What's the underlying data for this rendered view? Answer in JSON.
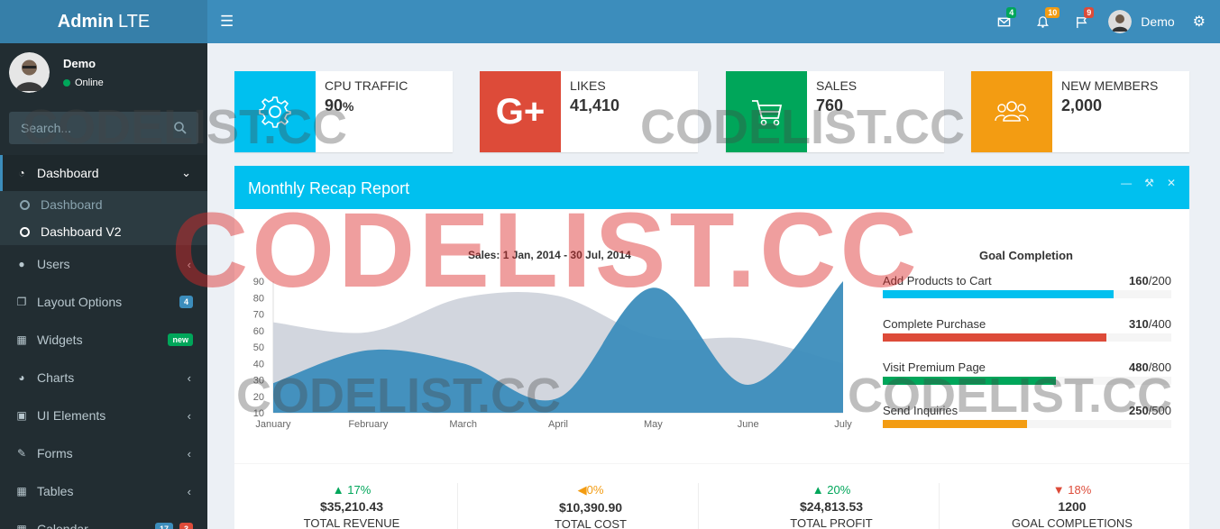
{
  "app": {
    "logo_bold": "Admin",
    "logo_rest": "LTE"
  },
  "navbar": {
    "toggle_icon": "hamburger-icon",
    "messages_badge": "4",
    "notifications_badge": "10",
    "tasks_badge": "9",
    "user_name": "Demo",
    "colors": {
      "messages": "#00a65a",
      "notifications": "#f39c12",
      "tasks": "#dd4b39"
    }
  },
  "sidebar": {
    "user_name": "Demo",
    "user_status": "Online",
    "search_placeholder": "Search...",
    "items": [
      {
        "label": "Dashboard",
        "icon": "dashboard-icon",
        "active": true
      },
      {
        "label": "Users",
        "icon": "users-icon"
      },
      {
        "label": "Layout Options",
        "icon": "files-icon",
        "badge": "4",
        "badge_color": "#3c8dbc"
      },
      {
        "label": "Widgets",
        "icon": "grid-icon",
        "badge": "new",
        "badge_color": "#00a65a"
      },
      {
        "label": "Charts",
        "icon": "pie-chart-icon"
      },
      {
        "label": "UI Elements",
        "icon": "laptop-icon"
      },
      {
        "label": "Forms",
        "icon": "edit-icon"
      },
      {
        "label": "Tables",
        "icon": "table-icon"
      },
      {
        "label": "Calendar",
        "icon": "calendar-icon",
        "badge": "17",
        "badge2": "3"
      }
    ],
    "subitems": [
      "Dashboard",
      "Dashboard V2"
    ]
  },
  "info_boxes": [
    {
      "label": "CPU TRAFFIC",
      "value": "90",
      "unit": "%",
      "color": "#00c0ef",
      "icon": "gear-icon"
    },
    {
      "label": "LIKES",
      "value": "41,410",
      "color": "#dd4b39",
      "icon": "google-plus-icon"
    },
    {
      "label": "SALES",
      "value": "760",
      "color": "#00a65a",
      "icon": "shopping-cart-icon"
    },
    {
      "label": "NEW MEMBERS",
      "value": "2,000",
      "color": "#f39c12",
      "icon": "people-icon"
    }
  ],
  "report": {
    "title": "Monthly Recap Report",
    "chart_title": "Sales: 1 Jan, 2014 - 30 Jul, 2014",
    "goal_title": "Goal Completion",
    "goals": [
      {
        "label": "Add Products to Cart",
        "done": "160",
        "total": "/200",
        "fraction": 0.8,
        "color": "#00c0ef"
      },
      {
        "label": "Complete Purchase",
        "done": "310",
        "total": "/400",
        "fraction": 0.775,
        "color": "#dd4b39"
      },
      {
        "label": "Visit Premium Page",
        "done": "480",
        "total": "/800",
        "fraction": 0.6,
        "color": "#00a65a"
      },
      {
        "label": "Send Inquiries",
        "done": "250",
        "total": "/500",
        "fraction": 0.5,
        "color": "#f39c12"
      }
    ],
    "descriptions": [
      {
        "pct": "17%",
        "dir": "up",
        "color": "#00a65a",
        "value": "$35,210.43",
        "label": "TOTAL REVENUE"
      },
      {
        "pct": "0%",
        "dir": "flat",
        "color": "#f39c12",
        "value": "$10,390.90",
        "label": "TOTAL COST"
      },
      {
        "pct": "20%",
        "dir": "up",
        "color": "#00a65a",
        "value": "$24,813.53",
        "label": "TOTAL PROFIT"
      },
      {
        "pct": "18%",
        "dir": "down",
        "color": "#dd4b39",
        "value": "1200",
        "label": "GOAL COMPLETIONS"
      }
    ]
  },
  "chart_data": {
    "type": "area",
    "title": "Sales: 1 Jan, 2014 - 30 Jul, 2014",
    "categories": [
      "January",
      "February",
      "March",
      "April",
      "May",
      "June",
      "July"
    ],
    "ylim": [
      10,
      90
    ],
    "yticks": [
      10,
      20,
      30,
      40,
      50,
      60,
      70,
      80,
      90
    ],
    "series": [
      {
        "values": [
          65,
          59,
          80,
          81,
          56,
          55,
          40
        ],
        "color": "#d2d6de"
      },
      {
        "values": [
          28,
          48,
          40,
          19,
          86,
          27,
          90
        ],
        "color": "#3c8dbc"
      }
    ]
  },
  "watermark": {
    "text": "CODELIST.CC"
  }
}
